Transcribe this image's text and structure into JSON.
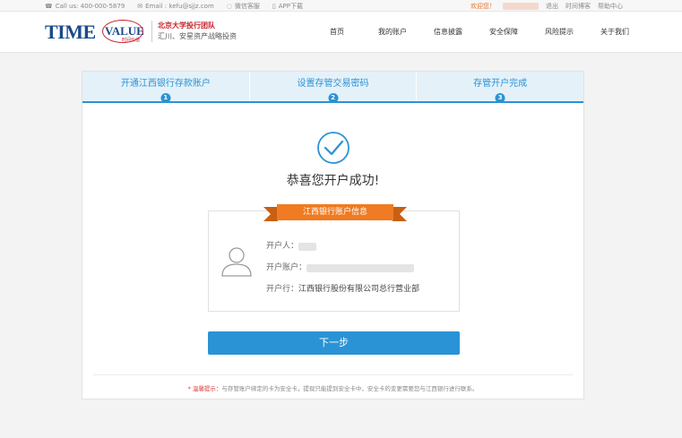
{
  "topbar": {
    "phone": "Call us: 400-000-5879",
    "email": "Email : kefu@sjjz.com",
    "wechat": "微信客服",
    "app": "APP下载",
    "welcome": "欢迎您！",
    "logout": "退出",
    "blog": "时间博客",
    "help": "帮助中心"
  },
  "header": {
    "logo_time": "TIME",
    "logo_value": "VALUE",
    "logo_sub": "时间价值",
    "slogan_line1": "北京大学投行团队",
    "slogan_line2": "汇川、安星资产战略投资",
    "nav": [
      "首页",
      "我的账户",
      "信息披露",
      "安全保障",
      "风险提示",
      "关于我们"
    ]
  },
  "steps": [
    {
      "label": "开通江西银行存款账户",
      "num": "1"
    },
    {
      "label": "设置存管交易密码",
      "num": "2"
    },
    {
      "label": "存管开户完成",
      "num": "3"
    }
  ],
  "success_text": "恭喜您开户成功!",
  "account_info": {
    "ribbon": "江西银行账户信息",
    "holder_label": "开户人：",
    "account_label": "开户账户：",
    "bank_label": "开户行：",
    "bank_value": "江西银行股份有限公司总行营业部"
  },
  "next_button": "下一步",
  "tip": {
    "star": "*",
    "head": "温馨提示：",
    "text": "与存管账户绑定的卡为安全卡，提现只能提到安全卡中，安全卡的变更需要您与江西银行进行联系。"
  },
  "colors": {
    "primary": "#2a93d5",
    "ribbon": "#f07b22",
    "brand_red": "#c8202a",
    "brand_blue": "#1a4a8a"
  }
}
